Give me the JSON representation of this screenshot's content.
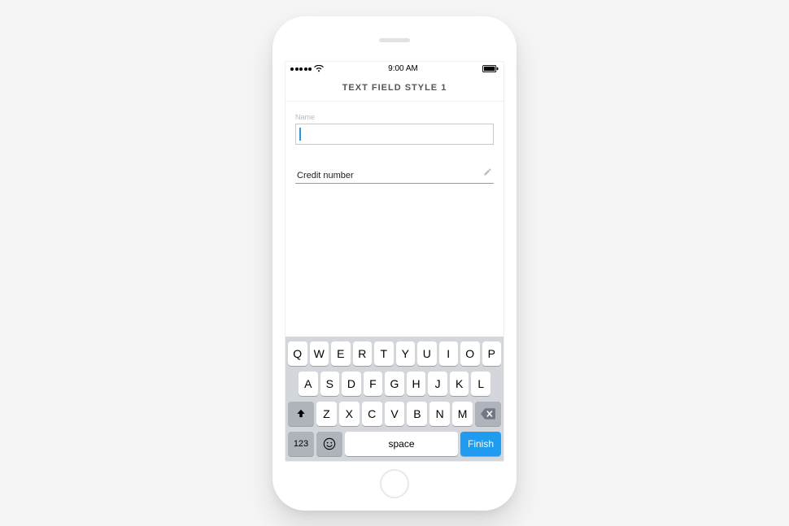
{
  "statusBar": {
    "time": "9:00 AM"
  },
  "header": {
    "title": "TEXT FIELD STYLE 1"
  },
  "form": {
    "nameField": {
      "label": "Name",
      "value": ""
    },
    "creditField": {
      "placeholder": "Credit number",
      "value": ""
    }
  },
  "keyboard": {
    "row1": [
      "Q",
      "W",
      "E",
      "R",
      "T",
      "Y",
      "U",
      "I",
      "O",
      "P"
    ],
    "row2": [
      "A",
      "S",
      "D",
      "F",
      "G",
      "H",
      "J",
      "K",
      "L"
    ],
    "row3": [
      "Z",
      "X",
      "C",
      "V",
      "B",
      "N",
      "M"
    ],
    "numKey": "123",
    "spaceLabel": "space",
    "returnLabel": "Finish"
  }
}
